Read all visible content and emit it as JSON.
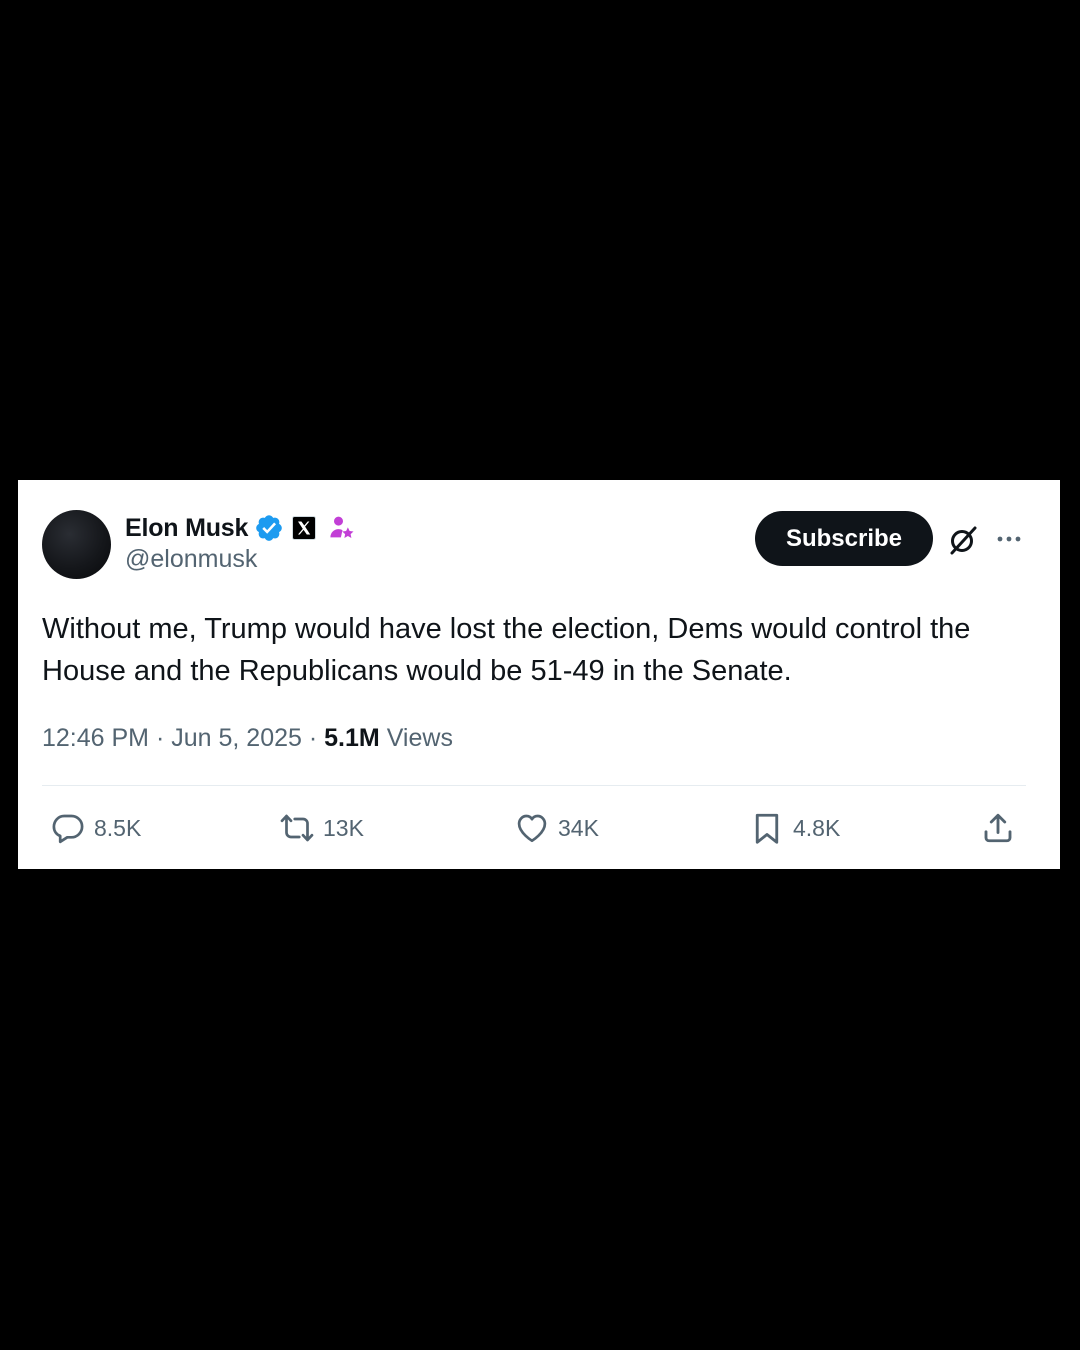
{
  "author": {
    "name": "Elon Musk",
    "handle": "@elonmusk"
  },
  "header": {
    "subscribe_label": "Subscribe"
  },
  "tweet": {
    "text": "Without me, Trump would have lost the election, Dems would control the House and the Republicans would be 51-49 in the Senate.",
    "time": "12:46 PM",
    "date": "Jun 5, 2025",
    "views_count": "5.1M",
    "views_label": "Views"
  },
  "actions": {
    "replies": "8.5K",
    "reposts": "13K",
    "likes": "34K",
    "bookmarks": "4.8K"
  },
  "colors": {
    "verified": "#1d9bf0",
    "affiliate": "#c23fd6",
    "text_primary": "#0f1419",
    "text_secondary": "#536471"
  }
}
